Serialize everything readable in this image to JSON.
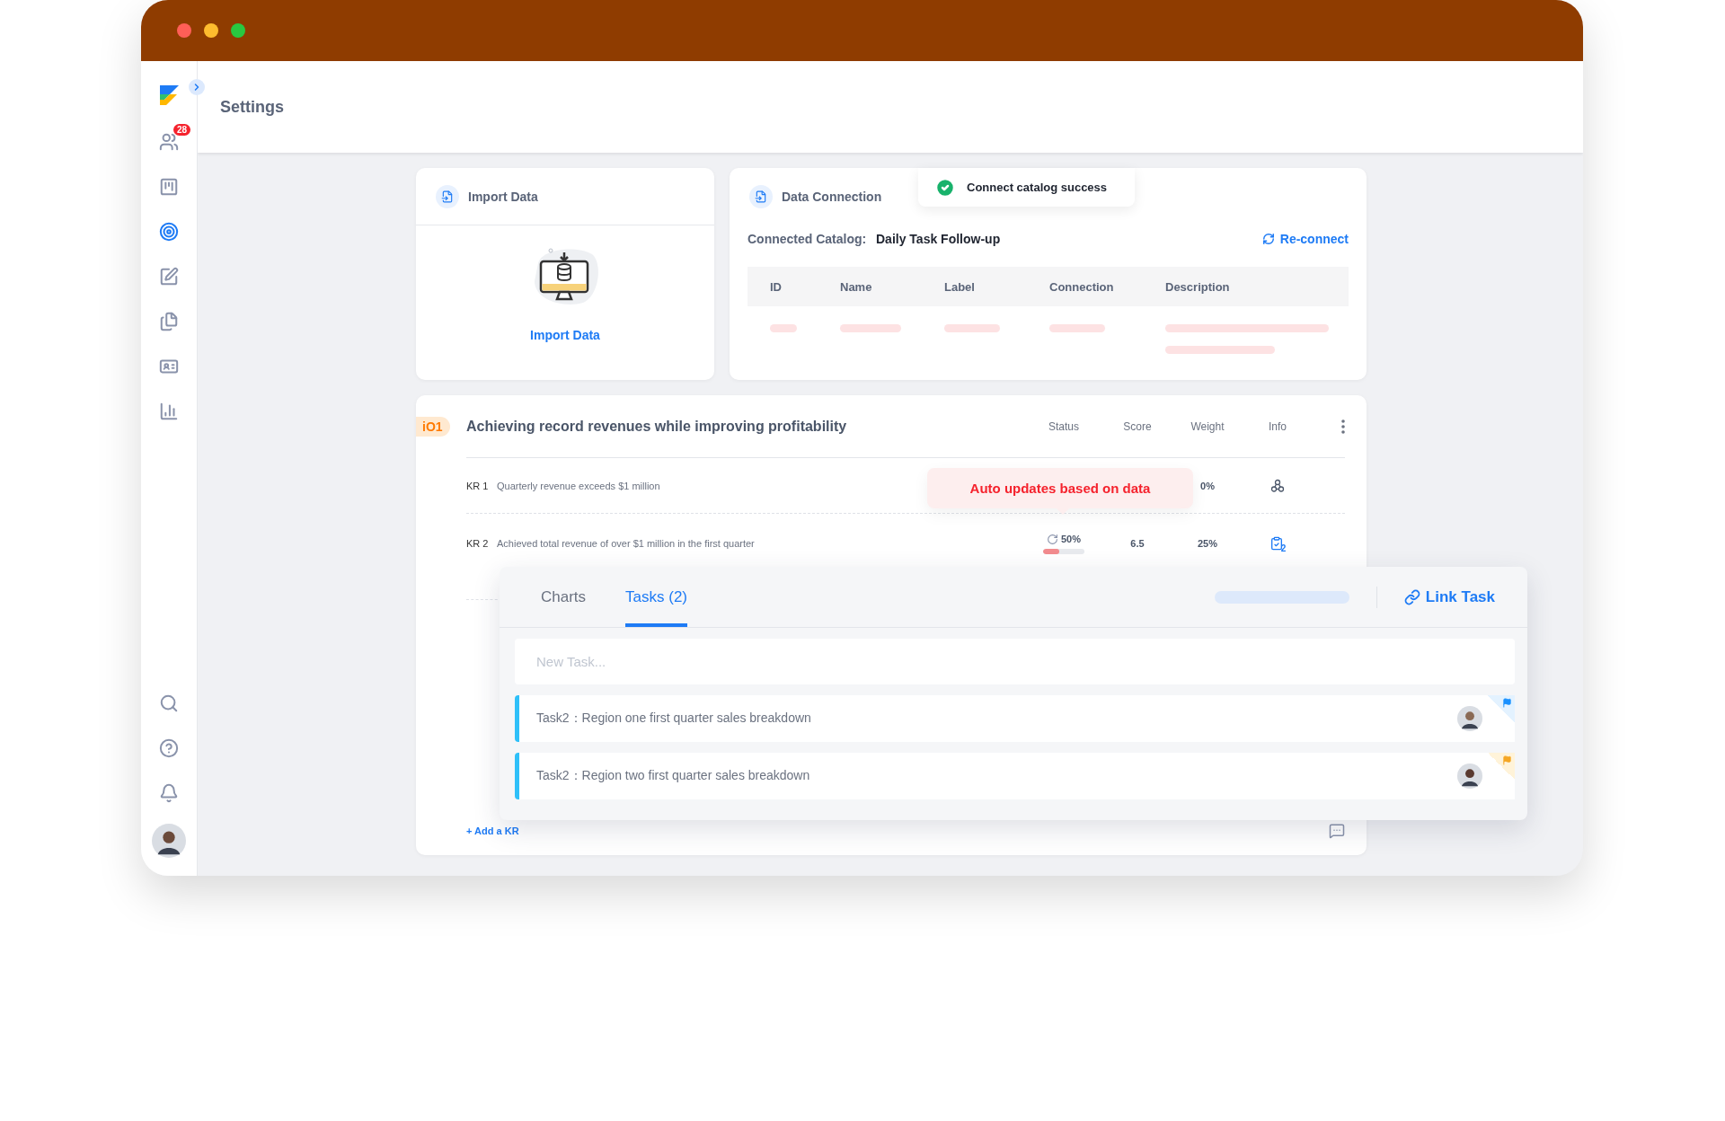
{
  "sidebar": {
    "items": [
      {
        "kind": "team",
        "badge": "28",
        "selected": false
      },
      {
        "kind": "board",
        "selected": false
      },
      {
        "kind": "target",
        "selected": true
      },
      {
        "kind": "edit",
        "selected": false
      },
      {
        "kind": "files",
        "selected": false
      },
      {
        "kind": "card",
        "selected": false
      },
      {
        "kind": "chart",
        "selected": false
      }
    ],
    "bottom_items": [
      {
        "kind": "search",
        "selected": false
      },
      {
        "kind": "help",
        "selected": false
      },
      {
        "kind": "bell",
        "selected": false
      }
    ]
  },
  "header": {
    "title": "Settings"
  },
  "import_card": {
    "title": "Import Data",
    "action": "Import Data"
  },
  "connection_card": {
    "title": "Data Connection",
    "catalog_label": "Connected Catalog:",
    "catalog_value": "Daily Task Follow-up",
    "reconnect": "Re-connect",
    "columns": [
      "ID",
      "Name",
      "Label",
      "Connection",
      "Description"
    ]
  },
  "toast": {
    "message": "Connect catalog success"
  },
  "objective": {
    "badge": "iO1",
    "title": "Achieving record revenues while improving profitability",
    "columns": [
      "Status",
      "Score",
      "Weight",
      "Info"
    ],
    "key_results": [
      {
        "code": "KR 1",
        "title": "Quarterly revenue exceeds $1 million",
        "weight": "0%",
        "info": {
          "kind": "nodes"
        }
      },
      {
        "code": "KR 2",
        "title": "Achieved total revenue of over $1 million in the first quarter",
        "status": "50%",
        "level": 0.4,
        "score": "6.5",
        "weight": "25%",
        "info": {
          "kind": "tasks",
          "count": "2"
        }
      }
    ],
    "add_kr": "+ Add a KR",
    "tooltip": "Auto updates based on data"
  },
  "task_panel": {
    "tabs": [
      {
        "label": "Charts",
        "selected": false
      },
      {
        "label": "Tasks (2)",
        "selected": true
      }
    ],
    "link": "Link Task",
    "new_task_placeholder": "New Task...",
    "tasks": [
      {
        "title": "Task2：Region one first quarter sales breakdown",
        "color": "#1890ff"
      },
      {
        "title": "Task2：Region two first quarter sales breakdown",
        "color": "#f5a623"
      }
    ]
  }
}
